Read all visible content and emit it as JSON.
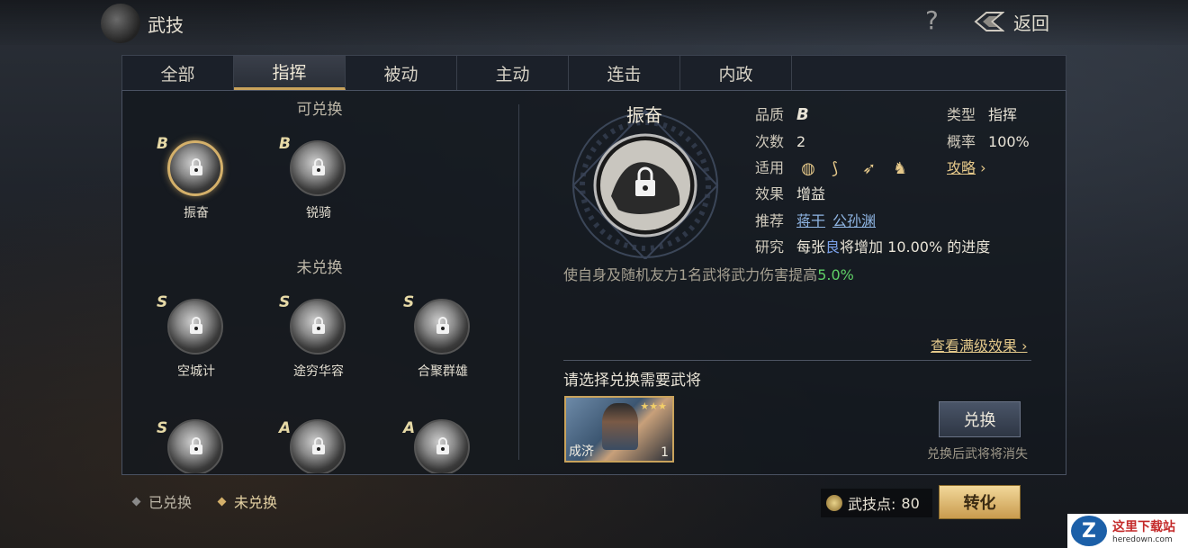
{
  "header": {
    "title": "武技",
    "help_label": "?",
    "back_label": "返回"
  },
  "tabs": [
    {
      "label": "全部",
      "active": false
    },
    {
      "label": "指挥",
      "active": true
    },
    {
      "label": "被动",
      "active": false
    },
    {
      "label": "主动",
      "active": false
    },
    {
      "label": "连击",
      "active": false
    },
    {
      "label": "内政",
      "active": false
    }
  ],
  "list": {
    "exchangeable_title": "可兑换",
    "not_exchanged_title": "未兑换",
    "exchangeable": [
      {
        "grade": "B",
        "name": "振奋",
        "selected": true
      },
      {
        "grade": "B",
        "name": "锐骑",
        "selected": false
      }
    ],
    "not_exchanged": [
      {
        "grade": "S",
        "name": "空城计"
      },
      {
        "grade": "S",
        "name": "途穷华容"
      },
      {
        "grade": "S",
        "name": "合聚群雄"
      },
      {
        "grade": "S",
        "name": ""
      },
      {
        "grade": "A",
        "name": ""
      },
      {
        "grade": "A",
        "name": ""
      }
    ]
  },
  "detail": {
    "name": "振奋",
    "quality_label": "品质",
    "quality": "B",
    "type_label": "类型",
    "type": "指挥",
    "count_label": "次数",
    "count": "2",
    "rate_label": "概率",
    "rate": "100%",
    "apply_label": "适用",
    "apply_icons": [
      "shield-icon",
      "bow-icon",
      "spear-icon",
      "horse-icon"
    ],
    "guide_label": "攻略",
    "effect_label": "效果",
    "effect": "增益",
    "recommend_label": "推荐",
    "recommend": [
      "蒋干",
      "公孙渊"
    ],
    "research_label": "研究",
    "research_text_1": "每张",
    "research_highlight": "良",
    "research_text_2": "将增加 10.00% 的进度",
    "description": "使自身及随机友方1名武将武力伤害提高",
    "description_value": "5.0%",
    "full_effect_link": "查看满级效果"
  },
  "exchange": {
    "prompt": "请选择兑换需要武将",
    "card_name": "成济",
    "card_count": "1",
    "card_stars": "★★★",
    "button_label": "兑换",
    "note": "兑换后武将将消失"
  },
  "footer": {
    "legend_exchanged": "已兑换",
    "legend_not_exchanged": "未兑换",
    "points_label": "武技点:",
    "points_value": "80",
    "convert_label": "转化"
  },
  "watermark": {
    "logo": "Z",
    "title": "这里下载站",
    "url": "heredown.com"
  },
  "colors": {
    "accent_gold": "#c9a35c",
    "link_blue": "#8fb5e3",
    "value_green": "#5fcf66"
  }
}
